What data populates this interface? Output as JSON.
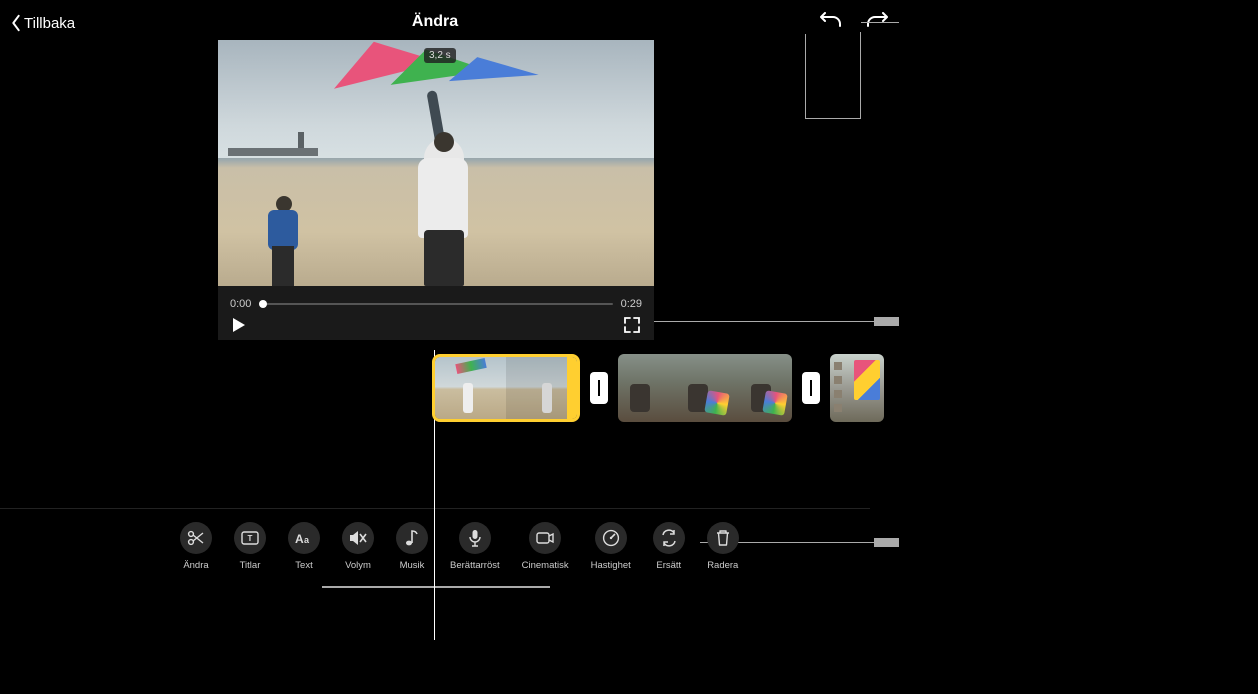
{
  "header": {
    "back_label": "Tillbaka",
    "title": "Ändra"
  },
  "player": {
    "clip_duration_badge": "3,2 s",
    "time_current": "0:00",
    "time_total": "0:29"
  },
  "timeline": {
    "clips": [
      {
        "has_title_overlay": true,
        "selected": true
      },
      {
        "has_title_overlay": false,
        "selected": false
      },
      {
        "has_title_overlay": false,
        "selected": false
      }
    ]
  },
  "toolbar": {
    "items": [
      {
        "id": "edit",
        "label": "Ändra",
        "icon": "scissors-icon"
      },
      {
        "id": "titles",
        "label": "Titlar",
        "icon": "title-card-icon"
      },
      {
        "id": "text",
        "label": "Text",
        "icon": "text-aa-icon"
      },
      {
        "id": "volume",
        "label": "Volym",
        "icon": "speaker-muted-icon"
      },
      {
        "id": "music",
        "label": "Musik",
        "icon": "music-note-icon"
      },
      {
        "id": "voiceover",
        "label": "Berättarröst",
        "icon": "microphone-icon"
      },
      {
        "id": "cinematic",
        "label": "Cinematisk",
        "icon": "camera-icon"
      },
      {
        "id": "speed",
        "label": "Hastighet",
        "icon": "speedometer-icon"
      },
      {
        "id": "replace",
        "label": "Ersätt",
        "icon": "replace-arrows-icon"
      },
      {
        "id": "delete",
        "label": "Radera",
        "icon": "trash-icon"
      }
    ]
  }
}
